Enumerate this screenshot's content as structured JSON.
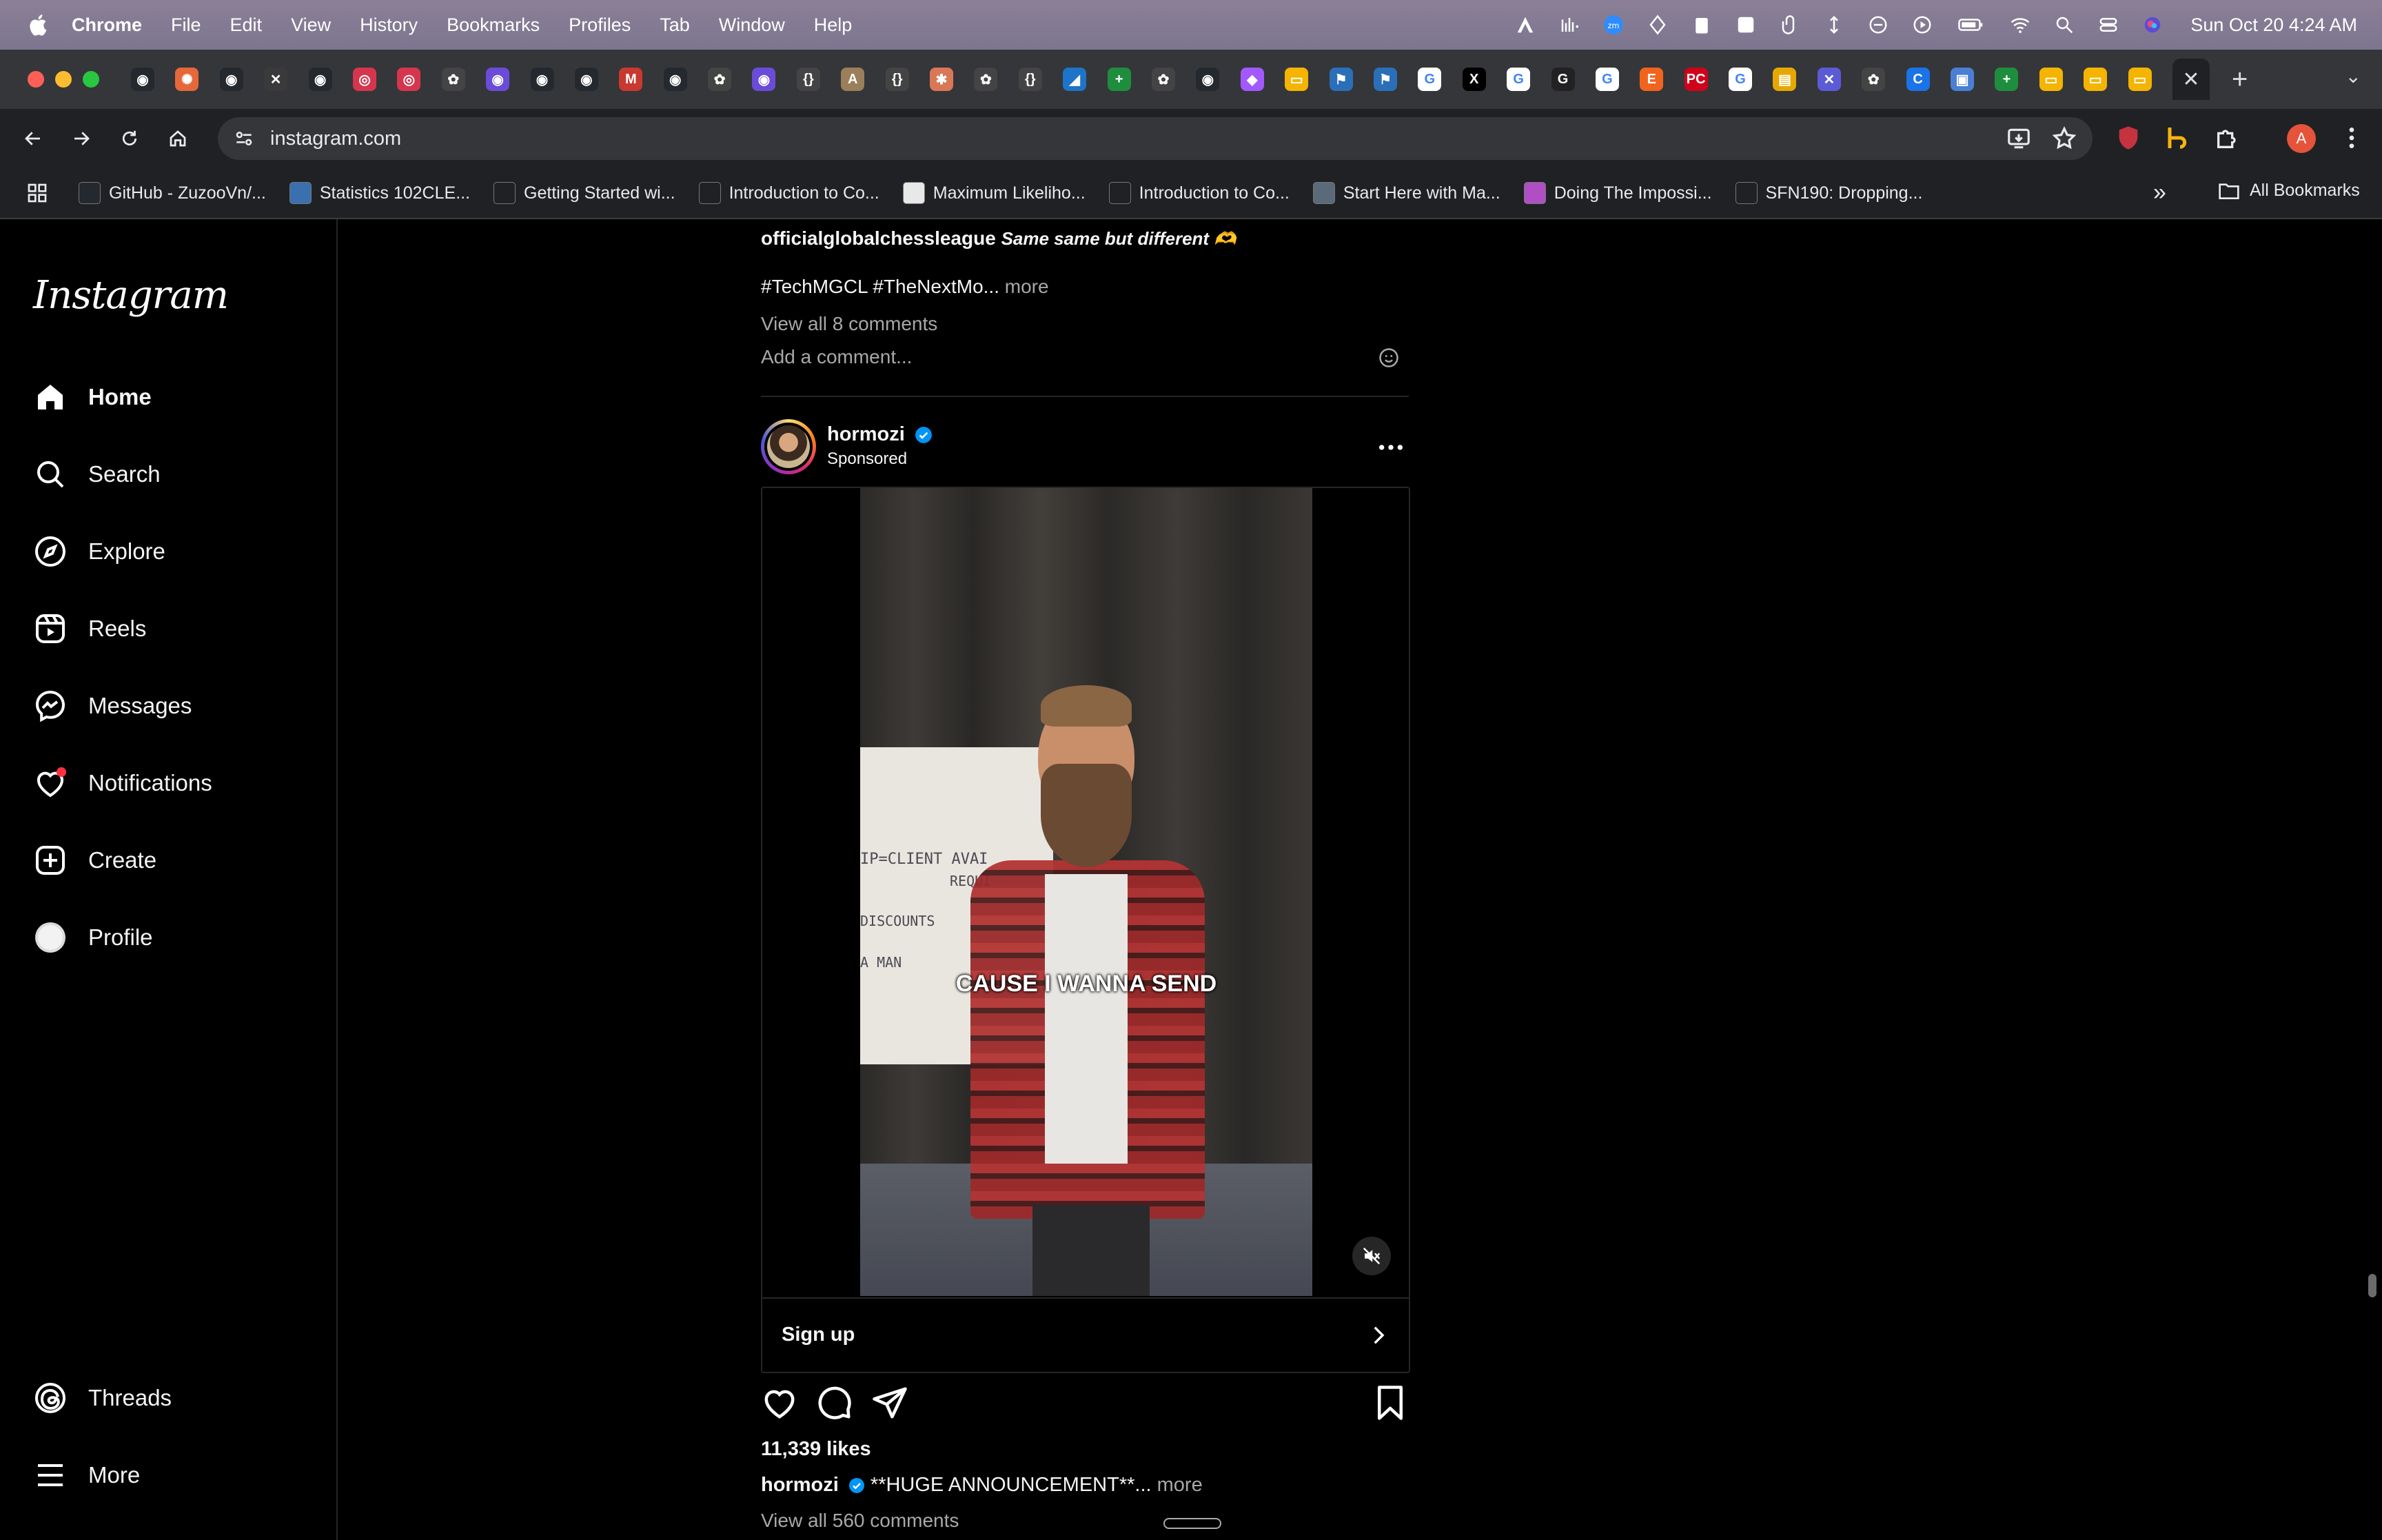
{
  "menubar": {
    "app": "Chrome",
    "items": [
      "File",
      "Edit",
      "View",
      "History",
      "Bookmarks",
      "Profiles",
      "Tab",
      "Window",
      "Help"
    ],
    "clock": "Sun Oct 20  4:24 AM"
  },
  "tabs": {
    "favicons": [
      {
        "icon": "github-icon",
        "color": "#24292f",
        "glyph": "◉"
      },
      {
        "icon": "openai-icon",
        "color": "#e5673a",
        "glyph": "✺"
      },
      {
        "icon": "github-icon",
        "color": "#24292f",
        "glyph": "◉"
      },
      {
        "icon": "x-icon",
        "color": "#3a3a3a",
        "glyph": "✕"
      },
      {
        "icon": "github-icon",
        "color": "#24292f",
        "glyph": "◉"
      },
      {
        "icon": "spiral-icon",
        "color": "#d6364d",
        "glyph": "◎"
      },
      {
        "icon": "spiral-icon",
        "color": "#d6364d",
        "glyph": "◎"
      },
      {
        "icon": "chatgpt-icon",
        "color": "#444",
        "glyph": "✿"
      },
      {
        "icon": "purple-icon",
        "color": "#6a4cd8",
        "glyph": "◉"
      },
      {
        "icon": "github-icon",
        "color": "#24292f",
        "glyph": "◉"
      },
      {
        "icon": "github-icon",
        "color": "#24292f",
        "glyph": "◉"
      },
      {
        "icon": "gmail-icon",
        "color": "#c9392f",
        "glyph": "M"
      },
      {
        "icon": "github-icon",
        "color": "#24292f",
        "glyph": "◉"
      },
      {
        "icon": "chatgpt-icon",
        "color": "#444",
        "glyph": "✿"
      },
      {
        "icon": "purple-icon",
        "color": "#6a4cd8",
        "glyph": "◉"
      },
      {
        "icon": "code-icon",
        "color": "#444",
        "glyph": "{}"
      },
      {
        "icon": "anthropic-icon",
        "color": "#9a7f5a",
        "glyph": "A"
      },
      {
        "icon": "code-icon",
        "color": "#444",
        "glyph": "{}"
      },
      {
        "icon": "claude-icon",
        "color": "#d97757",
        "glyph": "✱"
      },
      {
        "icon": "chatgpt-icon",
        "color": "#444",
        "glyph": "✿"
      },
      {
        "icon": "code-icon",
        "color": "#444",
        "glyph": "{}"
      },
      {
        "icon": "vscode-icon",
        "color": "#1d74c8",
        "glyph": "◢"
      },
      {
        "icon": "sheets-icon",
        "color": "#1e8e3e",
        "glyph": "+"
      },
      {
        "icon": "chatgpt-icon",
        "color": "#444",
        "glyph": "✿"
      },
      {
        "icon": "github-icon",
        "color": "#24292f",
        "glyph": "◉"
      },
      {
        "icon": "figma-icon",
        "color": "#a259ff",
        "glyph": "◆"
      },
      {
        "icon": "slides-icon",
        "color": "#f4b400",
        "glyph": "▭"
      },
      {
        "icon": "tool-icon",
        "color": "#2a6fb8",
        "glyph": "⚑"
      },
      {
        "icon": "tool-icon",
        "color": "#2a6fb8",
        "glyph": "⚑"
      },
      {
        "icon": "google-icon",
        "color": "#ffffff",
        "glyph": "G"
      },
      {
        "icon": "x-icon",
        "color": "#000",
        "glyph": "X"
      },
      {
        "icon": "google-icon",
        "color": "#ffffff",
        "glyph": "G"
      },
      {
        "icon": "g-icon",
        "color": "#222",
        "glyph": "G"
      },
      {
        "icon": "google-icon",
        "color": "#ffffff",
        "glyph": "G"
      },
      {
        "icon": "etsy-icon",
        "color": "#f1641e",
        "glyph": "E"
      },
      {
        "icon": "pc-icon",
        "color": "#d0021b",
        "glyph": "PC"
      },
      {
        "icon": "google-icon",
        "color": "#ffffff",
        "glyph": "G"
      },
      {
        "icon": "classroom-icon",
        "color": "#e6a800",
        "glyph": "▤"
      },
      {
        "icon": "puzzle-icon",
        "color": "#5b5bd6",
        "glyph": "✕"
      },
      {
        "icon": "chatgpt-icon",
        "color": "#444",
        "glyph": "✿"
      },
      {
        "icon": "edge-icon",
        "color": "#1a73e8",
        "glyph": "C"
      },
      {
        "icon": "photos-icon",
        "color": "#4a7fd4",
        "glyph": "▣"
      },
      {
        "icon": "sheets-icon",
        "color": "#1e8e3e",
        "glyph": "+"
      },
      {
        "icon": "slides-icon",
        "color": "#f4b400",
        "glyph": "▭"
      },
      {
        "icon": "slides-icon",
        "color": "#f4b400",
        "glyph": "▭"
      },
      {
        "icon": "slides-icon",
        "color": "#f4b400",
        "glyph": "▭"
      }
    ],
    "active_close": "✕",
    "new_tab": "+",
    "tab_search": "⌄"
  },
  "toolbar": {
    "url": "instagram.com",
    "profile_letter": "A"
  },
  "bookmarks": [
    {
      "label": "GitHub - ZuzooVn/...",
      "color": "#24292f"
    },
    {
      "label": "Statistics 102CLE...",
      "color": "#3a6fb0"
    },
    {
      "label": "Getting Started wi...",
      "color": "#202124"
    },
    {
      "label": "Introduction to Co...",
      "color": "#202124"
    },
    {
      "label": "Maximum Likeliho...",
      "color": "#e8e8e8"
    },
    {
      "label": "Introduction to Co...",
      "color": "#202124"
    },
    {
      "label": "Start Here with Ma...",
      "color": "#5a6a7a"
    },
    {
      "label": "Doing The Impossi...",
      "color": "#b04fc4"
    },
    {
      "label": "SFN190: Dropping...",
      "color": "#202124"
    }
  ],
  "bookmarks_more": "»",
  "bookmarks_all": "All Bookmarks",
  "instagram": {
    "logo": "Instagram",
    "nav": {
      "home": "Home",
      "search": "Search",
      "explore": "Explore",
      "reels": "Reels",
      "messages": "Messages",
      "notifications": "Notifications",
      "create": "Create",
      "profile": "Profile",
      "threads": "Threads",
      "more": "More"
    },
    "prev_post": {
      "user": "officialglobalchessleague",
      "caption": "Same same but different 🫶",
      "tags": "#TechMGCL #TheNextMo...",
      "more": "more",
      "view_all": "View all 8 comments",
      "add_comment": "Add a comment..."
    },
    "post": {
      "user": "hormozi",
      "sub": "Sponsored",
      "subtitle": "CAUSE I WANNA SEND",
      "whiteboard_text": [
        "IP=CLIENT AVAI",
        "REQUI",
        "DISCOUNTS",
        "A MAN"
      ],
      "cta": "Sign up",
      "likes": "11,339 likes",
      "caption_user": "hormozi",
      "caption": "**HUGE ANNOUNCEMENT**...",
      "more": "more",
      "view_all": "View all 560 comments"
    }
  }
}
